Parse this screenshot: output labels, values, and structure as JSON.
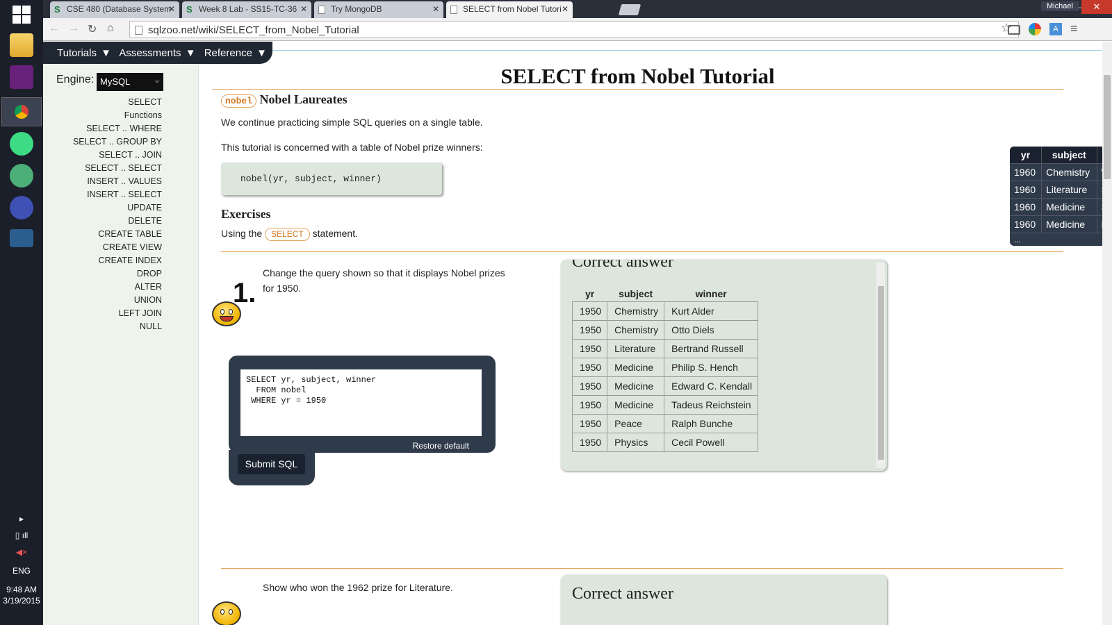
{
  "browser": {
    "tabs": [
      {
        "label": "CSE 480 (Database System",
        "fav": "S"
      },
      {
        "label": "Week 8 Lab - SS15-TC-36",
        "fav": "S"
      },
      {
        "label": "Try MongoDB",
        "fav": ""
      },
      {
        "label": "SELECT from Nobel Tutori",
        "fav": ""
      }
    ],
    "user": "Michael",
    "url": "sqlzoo.net/wiki/SELECT_from_Nobel_Tutorial"
  },
  "taskbar": {
    "lang": "ENG",
    "time": "9:48 AM",
    "date": "3/19/2015"
  },
  "menu": {
    "tutorials": "Tutorials ▼",
    "assessments": "Assessments ▼",
    "reference": "Reference ▼"
  },
  "sidebar": {
    "engine_label": "Engine:",
    "engine_value": "MySQL",
    "items": [
      "SELECT",
      "Functions",
      "SELECT .. WHERE",
      "SELECT .. GROUP BY",
      "SELECT .. JOIN",
      "SELECT .. SELECT",
      "INSERT .. VALUES",
      "INSERT .. SELECT",
      "UPDATE",
      "DELETE",
      "CREATE TABLE",
      "CREATE VIEW",
      "CREATE INDEX",
      "DROP",
      "ALTER",
      "UNION",
      "LEFT JOIN",
      "NULL"
    ]
  },
  "page": {
    "title": "SELECT from Nobel Tutorial",
    "table_pill": "nobel",
    "section_title": "Nobel Laureates",
    "intro1": "We continue practicing simple SQL queries on a single table.",
    "intro2": "This tutorial is concerned with a table of Nobel prize winners:",
    "schema": "nobel(yr, subject, winner)",
    "exercises_title": "Exercises",
    "using_pre": "Using the",
    "using_pill": "SELECT",
    "using_post": "statement."
  },
  "nobel_table": {
    "caption": "nobel",
    "headers": [
      "yr",
      "subject",
      "winner"
    ],
    "rows": [
      [
        "1960",
        "Chemistry",
        "Willard F. Libby"
      ],
      [
        "1960",
        "Literature",
        "Saint-John Perse"
      ],
      [
        "1960",
        "Medicine",
        "Sir Frank Macfarlane Burnet"
      ],
      [
        "1960",
        "Medicine",
        "Peter Medawar"
      ]
    ],
    "more": "..."
  },
  "q1": {
    "number": "1.",
    "text": "Change the query shown so that it displays Nobel prizes for 1950.",
    "sql": "SELECT yr, subject, winner\n  FROM nobel\n WHERE yr = 1950",
    "restore": "Restore default",
    "submit": "Submit SQL",
    "answer_title": "Correct answer",
    "answer_headers": [
      "yr",
      "subject",
      "winner"
    ],
    "answer_rows": [
      [
        "1950",
        "Chemistry",
        "Kurt Alder"
      ],
      [
        "1950",
        "Chemistry",
        "Otto Diels"
      ],
      [
        "1950",
        "Literature",
        "Bertrand Russell"
      ],
      [
        "1950",
        "Medicine",
        "Philip S. Hench"
      ],
      [
        "1950",
        "Medicine",
        "Edward C. Kendall"
      ],
      [
        "1950",
        "Medicine",
        "Tadeus Reichstein"
      ],
      [
        "1950",
        "Peace",
        "Ralph Bunche"
      ],
      [
        "1950",
        "Physics",
        "Cecil Powell"
      ]
    ]
  },
  "q2": {
    "text": "Show who won the 1962 prize for Literature.",
    "answer_title": "Correct answer"
  }
}
